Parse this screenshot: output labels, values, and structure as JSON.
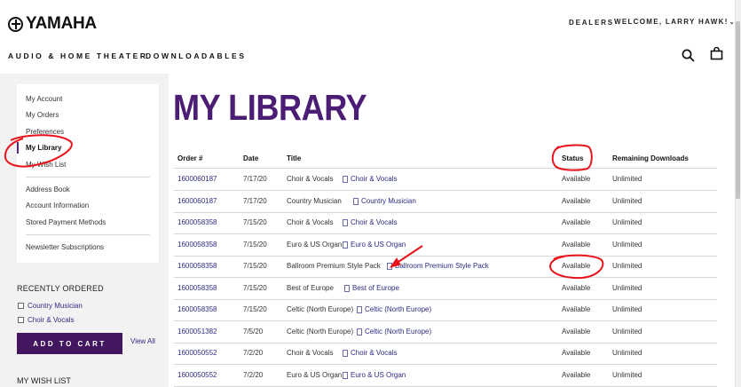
{
  "header": {
    "brand": "YAMAHA",
    "dealers": "DEALERS",
    "welcome": "WELCOME, LARRY HAWK!",
    "nav": [
      "AUDIO & HOME THEATER",
      "DOWNLOADABLES"
    ],
    "search_icon": "search-icon",
    "cart_icon": "shopping-bag-icon"
  },
  "sidebar": {
    "items": [
      {
        "label": "My Account"
      },
      {
        "label": "My Orders"
      },
      {
        "label": "Preferences"
      },
      {
        "label": "My Library",
        "active": true
      },
      {
        "label": "My Wish List"
      },
      {
        "label": "Address Book"
      },
      {
        "label": "Account Information"
      },
      {
        "label": "Stored Payment Methods"
      },
      {
        "label": "Newsletter Subscriptions"
      }
    ],
    "recently_ordered_title": "RECENTLY ORDERED",
    "recent_items": [
      "Country Musician",
      "Choir & Vocals"
    ],
    "add_to_cart": "ADD TO CART",
    "view_all": "View All",
    "wish_list_title": "MY WISH LIST"
  },
  "main": {
    "title": "MY LIBRARY",
    "columns": [
      "Order #",
      "Date",
      "Title",
      "Status",
      "Remaining Downloads"
    ],
    "rows": [
      {
        "order": "1600060187",
        "date": "7/17/20",
        "title": "Choir & Vocals",
        "link": "Choir & Vocals",
        "status": "Available",
        "remaining": "Unlimited"
      },
      {
        "order": "1600060187",
        "date": "7/17/20",
        "title": "Country Musician",
        "link": "Country Musician",
        "status": "Available",
        "remaining": "Unlimited"
      },
      {
        "order": "1600058358",
        "date": "7/15/20",
        "title": "Choir & Vocals",
        "link": "Choir & Vocals",
        "status": "Available",
        "remaining": "Unlimited"
      },
      {
        "order": "1600058358",
        "date": "7/15/20",
        "title": "Euro & US Organ",
        "link": "Euro & US Organ",
        "status": "Available",
        "remaining": "Unlimited"
      },
      {
        "order": "1600058358",
        "date": "7/15/20",
        "title": "Ballroom Premium Style Pack",
        "link": "Ballroom Premium Style Pack",
        "status": "Available",
        "remaining": "Unlimited"
      },
      {
        "order": "1600058358",
        "date": "7/15/20",
        "title": "Best of Europe",
        "link": "Best of Europe",
        "status": "Available",
        "remaining": "Unlimited"
      },
      {
        "order": "1600058358",
        "date": "7/15/20",
        "title": "Celtic (North Europe)",
        "link": "Celtic (North Europe)",
        "status": "Available",
        "remaining": "Unlimited"
      },
      {
        "order": "1600051382",
        "date": "7/5/20",
        "title": "Celtic (North Europe)",
        "link": "Celtic (North Europe)",
        "status": "Available",
        "remaining": "Unlimited"
      },
      {
        "order": "1600050552",
        "date": "7/2/20",
        "title": "Choir & Vocals",
        "link": "Choir & Vocals",
        "status": "Available",
        "remaining": "Unlimited"
      },
      {
        "order": "1600050552",
        "date": "7/2/20",
        "title": "Euro & US Organ",
        "link": "Euro & US Organ",
        "status": "Available",
        "remaining": "Unlimited"
      }
    ]
  },
  "colors": {
    "brand_purple": "#4b1d74",
    "button_purple": "#43175f",
    "link_blue": "#2d2b85",
    "annotation_red": "#e8141c"
  }
}
